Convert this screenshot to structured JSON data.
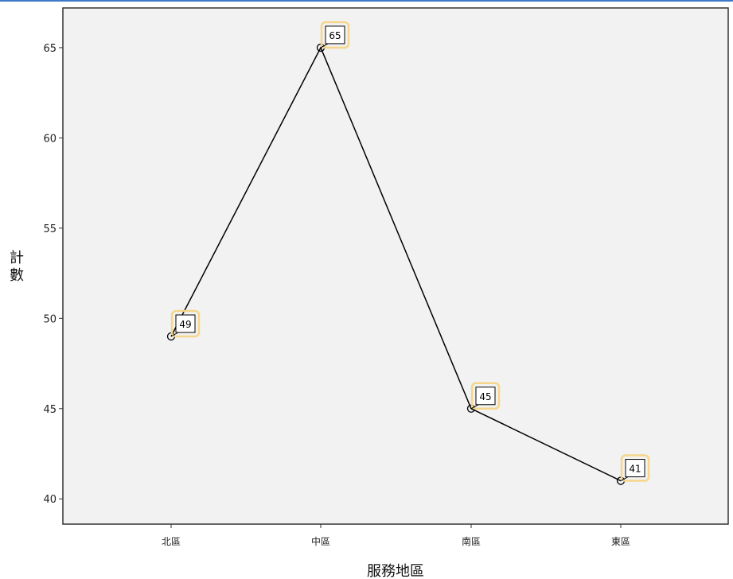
{
  "chart_data": {
    "type": "line",
    "categories": [
      "北區",
      "中區",
      "南區",
      "東區"
    ],
    "values": [
      49,
      65,
      45,
      41
    ],
    "data_labels": [
      "49",
      "65",
      "45",
      "41"
    ],
    "xlabel": "服務地區",
    "ylabel": "計數",
    "ylim": [
      38.6,
      67.2
    ],
    "yticks": [
      40,
      45,
      50,
      55,
      60,
      65
    ],
    "ytick_labels": [
      "40",
      "45",
      "50",
      "55",
      "60",
      "65"
    ],
    "grid": false,
    "colors": {
      "plot_background": "#f2f2f2",
      "line": "#000000",
      "marker": "#000000",
      "label_highlight": "#f5d68a",
      "top_border": "#3c78c8"
    }
  }
}
